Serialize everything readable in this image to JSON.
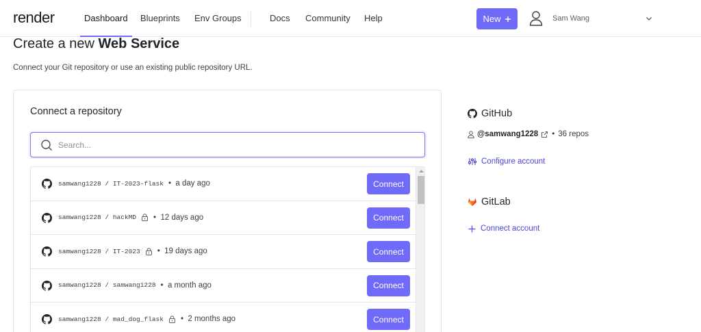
{
  "header": {
    "logo": "render",
    "nav": [
      "Dashboard",
      "Blueprints",
      "Env Groups",
      "Docs",
      "Community",
      "Help"
    ],
    "new_label": "New",
    "new_icon": "plus-icon",
    "user_name": "Sam Wang",
    "accent": "#6f6af8"
  },
  "page": {
    "title_prefix": "Create a new",
    "title_bold": "Web Service",
    "subtitle": "Connect your Git repository or use an existing public repository URL."
  },
  "repo_card": {
    "title": "Connect a repository",
    "search_placeholder": "Search...",
    "connect_label": "Connect",
    "repos": [
      {
        "name": "samwang1228 / IT-2023-flask",
        "private": false,
        "updated": "a day ago"
      },
      {
        "name": "samwang1228 / hackMD",
        "private": true,
        "updated": "12 days ago"
      },
      {
        "name": "samwang1228 / IT-2023",
        "private": true,
        "updated": "19 days ago"
      },
      {
        "name": "samwang1228 / samwang1228",
        "private": false,
        "updated": "a month ago"
      },
      {
        "name": "samwang1228 / mad_dog_flask",
        "private": true,
        "updated": "2 months ago"
      }
    ]
  },
  "github": {
    "title": "GitHub",
    "handle": "@samwang1228",
    "repo_count": "36 repos",
    "configure_label": "Configure account"
  },
  "gitlab": {
    "title": "GitLab",
    "connect_label": "Connect account",
    "brand_color": "#e24329"
  }
}
